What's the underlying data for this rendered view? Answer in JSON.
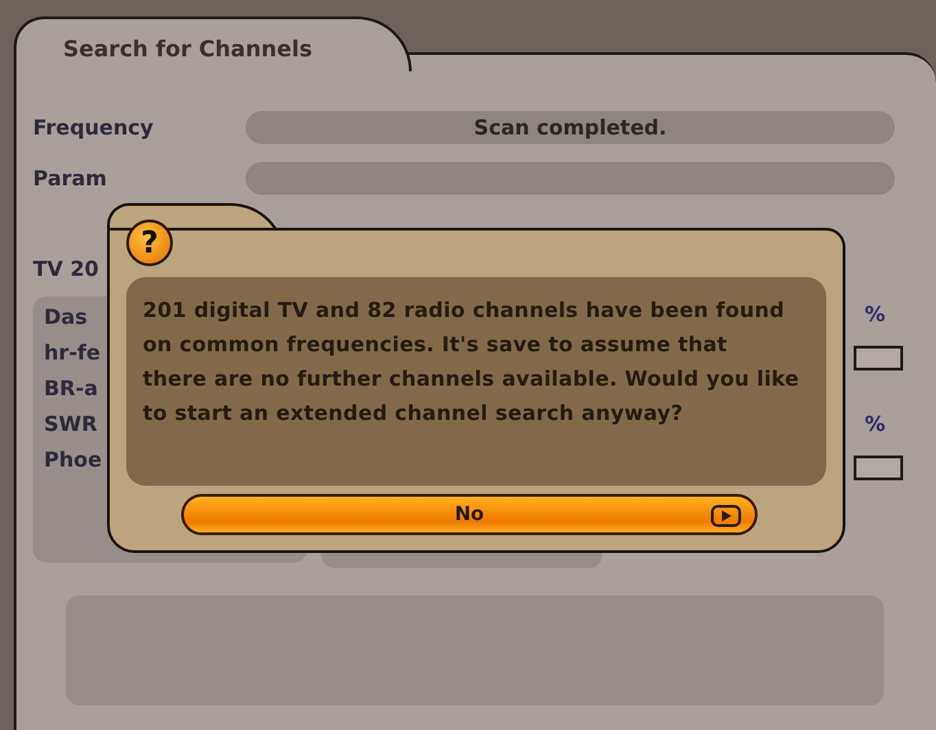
{
  "window": {
    "title": "Search for Channels"
  },
  "fields": [
    {
      "label": "Frequency",
      "value": "Scan completed."
    },
    {
      "label": "Param"
    }
  ],
  "tv_label": "TV 20",
  "channel_list": [
    "Das",
    "hr-fe",
    "BR-a",
    "SWR",
    "Phoe"
  ],
  "right_readings": [
    "%",
    "%"
  ],
  "dialog": {
    "icon": "?",
    "message_lines": [
      "201 digital TV and 82 radio channels have been found",
      "on common frequencies. It's save to assume that",
      "there are no further channels available. Would you like",
      "to start an extended channel search anyway?"
    ],
    "button": {
      "label": "No",
      "selected": true
    }
  }
}
